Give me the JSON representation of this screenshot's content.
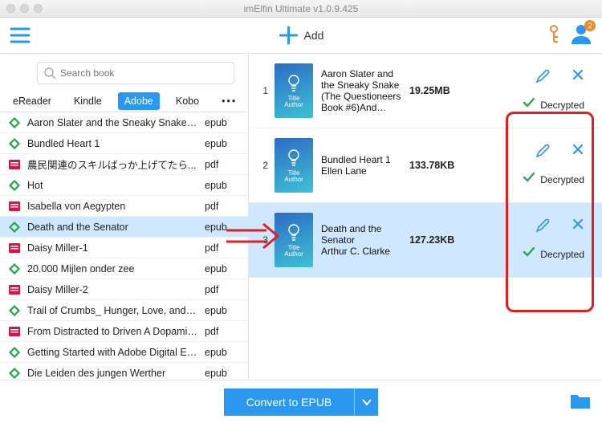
{
  "app": {
    "title": "imElfin Ultimate v1.0.9.425",
    "add_label": "Add",
    "badge_count": "2"
  },
  "search": {
    "placeholder": "Search book"
  },
  "tabs": [
    "eReader",
    "Kindle",
    "Adobe",
    "Kobo"
  ],
  "active_tab_index": 2,
  "cover_label_line1": "Title",
  "cover_label_line2": "Author",
  "books": [
    {
      "title": "Aaron Slater and the Sneaky Snake (...",
      "format": "epub",
      "icon": "epub"
    },
    {
      "title": "Bundled Heart 1",
      "format": "epub",
      "icon": "epub"
    },
    {
      "title": "農民関連のスキルばっか上げてたら...",
      "format": "pdf",
      "icon": "pdf"
    },
    {
      "title": "Hot",
      "format": "epub",
      "icon": "epub"
    },
    {
      "title": "Isabella von Aegypten",
      "format": "pdf",
      "icon": "pdf"
    },
    {
      "title": "Death and the Senator",
      "format": "epub",
      "icon": "epub",
      "selected": true
    },
    {
      "title": "Daisy Miller-1",
      "format": "pdf",
      "icon": "pdf"
    },
    {
      "title": "20.000 Mijlen onder zee",
      "format": "epub",
      "icon": "epub"
    },
    {
      "title": "Daisy Miller-2",
      "format": "pdf",
      "icon": "pdf"
    },
    {
      "title": "Trail of Crumbs_ Hunger, Love, and t...",
      "format": "epub",
      "icon": "epub"
    },
    {
      "title": "From Distracted to Driven A Dopamin...",
      "format": "pdf",
      "icon": "pdf"
    },
    {
      "title": "Getting Started with Adobe Digital Edi...",
      "format": "epub",
      "icon": "epub"
    },
    {
      "title": "Die Leiden des jungen Werther",
      "format": "epub",
      "icon": "epub"
    }
  ],
  "processed": [
    {
      "idx": "1",
      "title": "Aaron Slater and the Sneaky Snake (The Questioneers Book #6)And…",
      "author": "",
      "size": "19.25MB",
      "status": "Decrypted"
    },
    {
      "idx": "2",
      "title": "Bundled Heart 1",
      "author": "Ellen Lane",
      "size": "133.78KB",
      "status": "Decrypted"
    },
    {
      "idx": "3",
      "title": "Death and the Senator",
      "author": "Arthur C. Clarke",
      "size": "127.23KB",
      "status": "Decrypted",
      "selected": true
    }
  ],
  "convert": {
    "label": "Convert to EPUB"
  },
  "colors": {
    "accent": "#2a97f0",
    "ok": "#2fa84f",
    "annot": "#e11f1f"
  }
}
